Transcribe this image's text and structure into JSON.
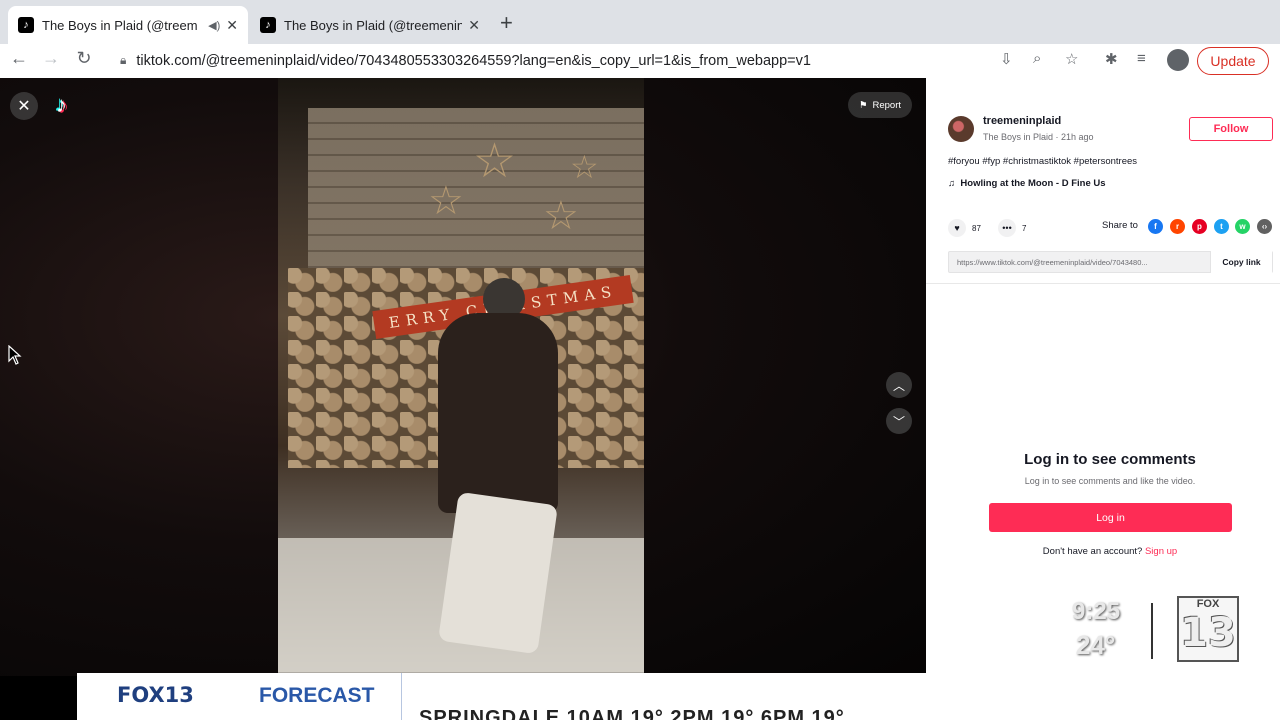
{
  "browser": {
    "tabs": [
      {
        "title": "The Boys in Plaid (@treem",
        "active": true,
        "audio": true
      },
      {
        "title": "The Boys in Plaid (@treemenin",
        "active": false
      }
    ],
    "url": "tiktok.com/@treemeninplaid/video/7043480553303264559?lang=en&is_copy_url=1&is_from_webapp=v1",
    "update_label": "Update"
  },
  "video_overlay": {
    "report_label": "Report",
    "banner_text": "ERRY CHRISTMAS"
  },
  "panel": {
    "username": "treemeninplaid",
    "subtitle": "The Boys in Plaid · 21h ago",
    "follow_label": "Follow",
    "hashtags": "#foryou #fyp #christmastiktok #petersontrees",
    "music": "Howling at the Moon - D Fine Us",
    "likes": "87",
    "comments": "7",
    "share_label": "Share to",
    "link_text": "https://www.tiktok.com/@treemeninplaid/video/7043480...",
    "copy_label": "Copy link",
    "login_title": "Log in to see comments",
    "login_sub": "Log in to see comments and like the video.",
    "login_button": "Log in",
    "signup_prompt": "Don't have an account?",
    "signup_link": "Sign up"
  },
  "broadcast": {
    "time": "9:25",
    "temp": "24°",
    "bug_top": "FOX",
    "bug_number": "13",
    "lower_brand": "FOX13",
    "lower_title": "FORECAST",
    "ticker": "SPRINGDALE 10AM 19° 2PM 19° 6PM 19°"
  },
  "colors": {
    "tiktok_red": "#fe2c55",
    "chrome_tabbar": "#dee1e6",
    "fox_blue": "#1f3f7f"
  }
}
